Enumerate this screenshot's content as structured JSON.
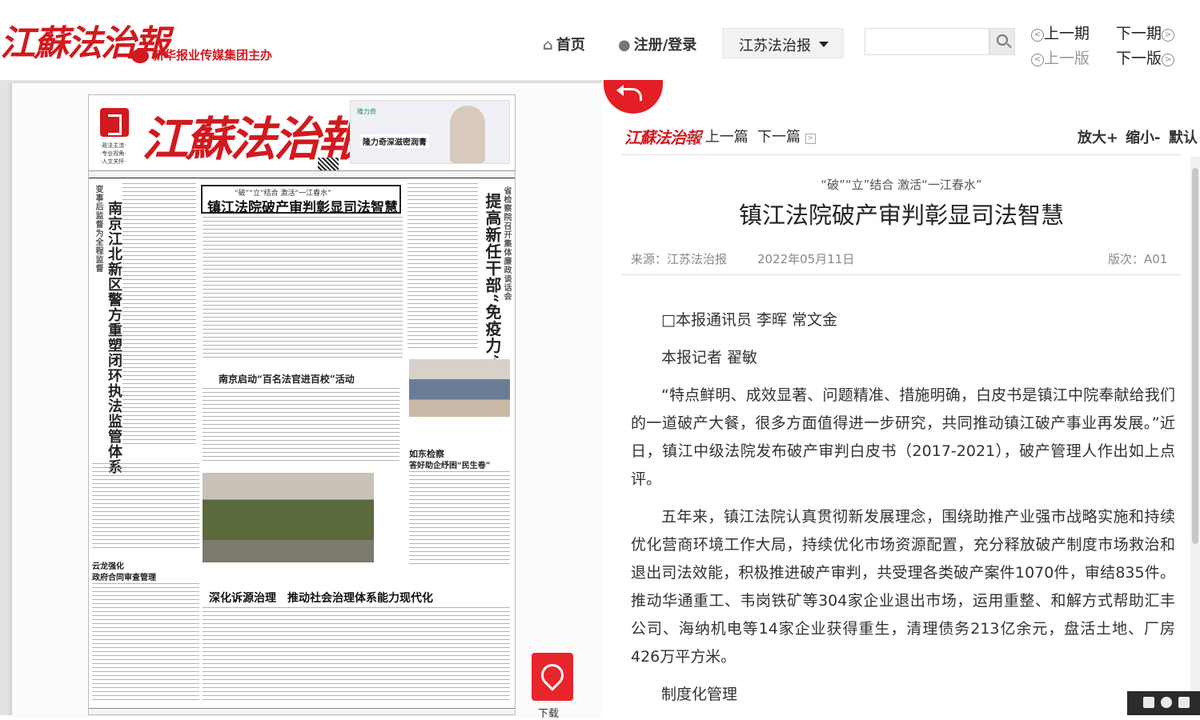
{
  "header": {
    "logo_text": "江蘇法治報",
    "logo_sub": "报业传媒集团主办",
    "logo_sub_brand": "新华",
    "nav": {
      "home": "首页",
      "login": "注册/登录"
    },
    "paper_select": "江苏法治报",
    "search": {
      "placeholder": ""
    },
    "issue_nav": {
      "prev_issue": "上一期",
      "next_issue": "下一期",
      "prev_page": "上一版",
      "next_page": "下一版"
    }
  },
  "newspaper": {
    "title": "江蘇法治報",
    "tags": [
      "·政法主流·",
      "·专业视角·",
      "·人文关怀·"
    ],
    "ad_brand": "隆力奇",
    "ad_slogan": "隆力奇深滋密润膏",
    "headline_kicker": "“破”“立”结合 激活“一江春水”",
    "headline_main": "镇江法院破产审判彰显司法智慧",
    "left_vertical": "南京江北新区警方重塑闭环执法监管体系",
    "left_vertical_small": "变事后监督为全程监督",
    "right_vertical": "提高新任干部“免疫力”",
    "right_vertical_small": "省检察院召开集体廉政谈话会",
    "story2": "南京启动“百名法官进百校”活动",
    "story3": "如东检察",
    "story3b": "答好助企纾困“民生卷”",
    "story4": "云龙强化",
    "story4b": "政府合同审查管理",
    "bottom_head": "深化诉源治理　推动社会治理体系能力现代化",
    "pdf_label": "下载"
  },
  "article": {
    "logo": "江蘇法治報",
    "prev": "上一篇",
    "next": "下一篇",
    "zoom_in": "放大+",
    "zoom_out": "缩小-",
    "default": "默认",
    "kicker": "“破”“立”结合 激活“一江春水”",
    "title": "镇江法院破产审判彰显司法智慧",
    "source": "来源：江苏法治报",
    "date": "2022年05月11日",
    "page": "版次：A01",
    "byline1": "□本报通讯员 李晖 常文金",
    "byline2": "本报记者 翟敏",
    "p1": "“特点鲜明、成效显著、问题精准、措施明确，白皮书是镇江中院奉献给我们的一道破产大餐，很多方面值得进一步研究，共同推动镇江破产事业再发展。”近日，镇江中级法院发布破产审判白皮书（2017-2021），破产管理人作出如上点评。",
    "p2": "五年来，镇江法院认真贯彻新发展理念，围绕助推产业强市战略实施和持续优化营商环境工作大局，持续优化市场资源配置，充分释放破产制度市场救治和退出司法效能，积极推进破产审判，共受理各类破产案件1070件，审结835件。推动华通重工、韦岗铁矿等304家企业退出市场，运用重整、和解方式帮助汇丰公司、海纳机电等14家企业获得重生，清理债务213亿余元，盘活土地、厂房426万平方米。",
    "p3": "制度化管理"
  },
  "colors": {
    "brand_red": "#d11a1f",
    "pdf_red": "#e8252b"
  }
}
